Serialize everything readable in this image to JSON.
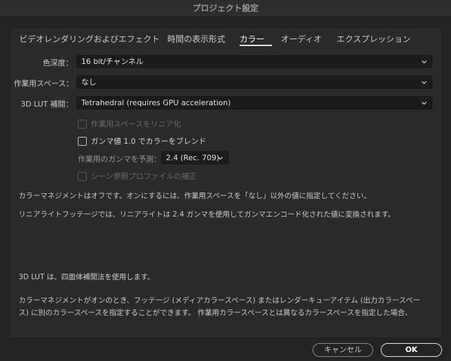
{
  "window": {
    "title": "プロジェクト設定"
  },
  "tabs": [
    {
      "label": "ビデオレンダリングおよびエフェクト"
    },
    {
      "label": "時間の表示形式"
    },
    {
      "label": "カラー"
    },
    {
      "label": "オーディオ"
    },
    {
      "label": "エクスプレッション"
    }
  ],
  "active_tab_index": 2,
  "color": {
    "bit_depth": {
      "label": "色深度：",
      "value": "16 bit/チャンネル"
    },
    "working_space": {
      "label": "作業用スペース：",
      "value": "なし"
    },
    "lut_interp": {
      "label": "3D LUT 補間：",
      "value": "Tetrahedral (requires GPU acceleration)"
    },
    "linearize": {
      "label": "作業用スペースをリニア化",
      "checked": false,
      "enabled": false
    },
    "blend_gamma": {
      "label": "ガンマ値 1.0 でカラーをブレンド",
      "checked": false,
      "enabled": true
    },
    "predict_gamma": {
      "label": "作業用のガンマを予測：",
      "value": "2.4 (Rec. 709)"
    },
    "scene_profile": {
      "label": "シーン参照プロファイルの補正",
      "checked": false,
      "enabled": false
    }
  },
  "info": {
    "p1": "カラーマネジメントはオフです。オンにするには、作業用スペースを「なし」以外の値に指定してください。",
    "p2": "リニアライトフッテージでは、リニアライトは 2.4 ガンマを使用してガンマエンコード化された値に変換されます。",
    "p3": "3D LUT は、四面体補間法を使用します。",
    "p4_line1": "カラーマネジメントがオンのとき、フッテージ (メディアカラースペース) またはレンダーキューアイテム (出力カラースペー",
    "p4_line2": "ス) に別のカラースペースを指定することができます。 作業用カラースペースとは異なるカラースペースを指定した場合、"
  },
  "buttons": {
    "cancel": "キャンセル",
    "ok": "OK"
  },
  "colors": {
    "background": "#232323",
    "panel": "#2a2a2a",
    "field": "#1b1b1b",
    "text": "#d4d4d4"
  }
}
